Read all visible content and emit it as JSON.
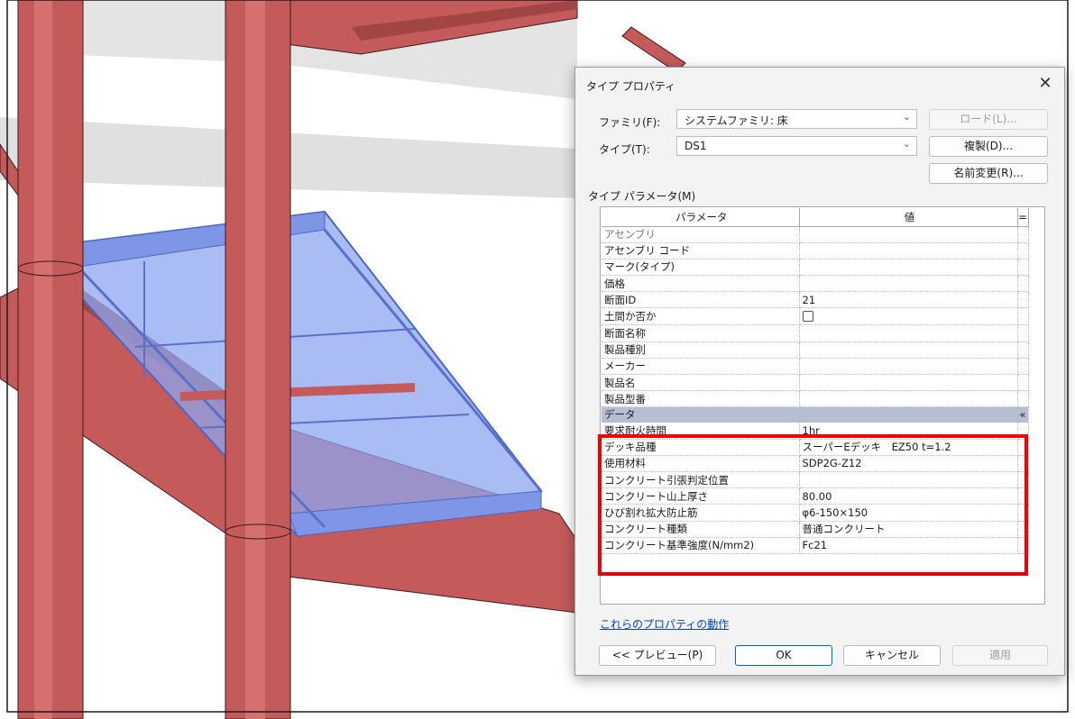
{
  "dialog": {
    "title": "タイプ プロパティ",
    "family_label": "ファミリ(F):",
    "family_value": "システムファミリ: 床",
    "type_label": "タイプ(T):",
    "type_value": "DS1",
    "load_button": "ロード(L)...",
    "duplicate_button": "複製(D)...",
    "rename_button": "名前変更(R)...",
    "type_params_label": "タイプ パラメータ(M)",
    "table": {
      "col_param": "パラメータ",
      "col_value": "値",
      "col_equals": "=",
      "rows_top": [
        {
          "param": "アセンブリ",
          "value": ""
        },
        {
          "param": "アセンブリ コード",
          "value": ""
        },
        {
          "param": "マーク(タイプ)",
          "value": ""
        },
        {
          "param": "価格",
          "value": ""
        },
        {
          "param": "断面ID",
          "value": "21"
        },
        {
          "param": "土間か否か",
          "value": ""
        },
        {
          "param": "断面名称",
          "value": ""
        },
        {
          "param": "製品種別",
          "value": ""
        },
        {
          "param": "メーカー",
          "value": ""
        },
        {
          "param": "製品名",
          "value": ""
        },
        {
          "param": "製品型番",
          "value": ""
        }
      ],
      "group": "データ",
      "group_toggle": "«",
      "rows_data": [
        {
          "param": "要求耐火時間",
          "value": "1hr"
        },
        {
          "param": "デッキ品種",
          "value": "スーパーEデッキ　EZ50 t=1.2"
        },
        {
          "param": "使用材料",
          "value": "SDP2G-Z12"
        },
        {
          "param": "コンクリート引張判定位置",
          "value": ""
        },
        {
          "param": "コンクリート山上厚さ",
          "value": "80.00"
        },
        {
          "param": "ひび割れ拡大防止筋",
          "value": "φ6-150×150"
        },
        {
          "param": "コンクリート種類",
          "value": "普通コンクリート"
        },
        {
          "param": "コンクリート基準強度(N/mm2)",
          "value": "Fc21"
        }
      ]
    },
    "properties_link": "これらのプロパティの動作",
    "preview_button": "<< プレビュー(P)",
    "ok_button": "OK",
    "cancel_button": "キャンセル",
    "apply_button": "適用"
  },
  "colors": {
    "steel": "#c45a5a",
    "slab_highlight": "#8ea6f0",
    "callout": "#ee0000",
    "group_header": "#b6bfd0"
  }
}
